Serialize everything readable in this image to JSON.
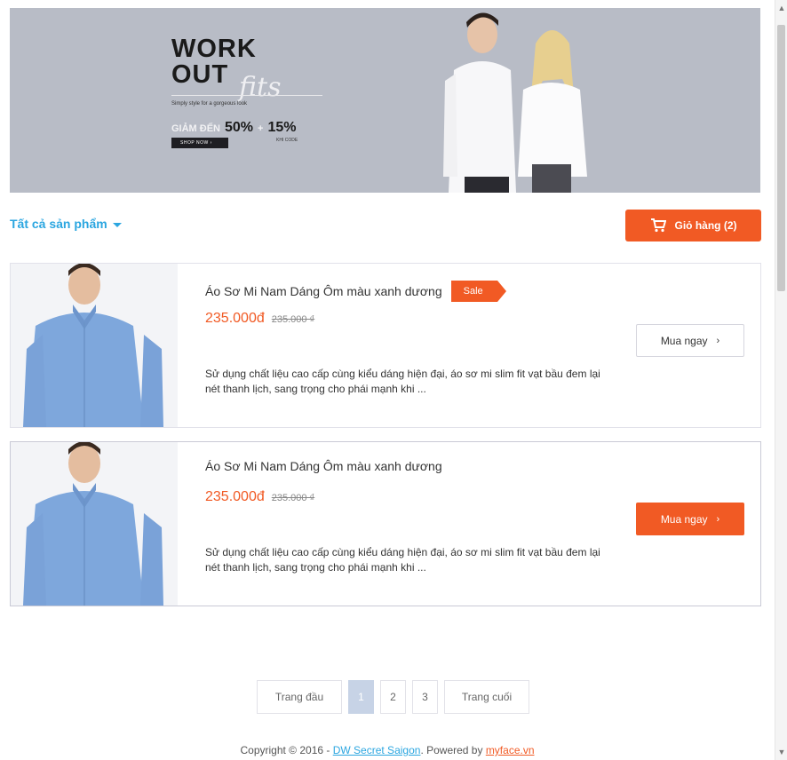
{
  "banner": {
    "headline_line1": "WORK",
    "headline_line2": "OUT",
    "script": "fits",
    "tagline": "Simply style for a gorgeous look",
    "sale_label": "GIẢM ĐẾN",
    "sale_pct1": "50%",
    "sale_plus": "+",
    "sale_pct2": "15%",
    "sale_note": "KHI CODE",
    "shop_label": "SHOP NOW ›",
    "bg_color": "#b8bcc6"
  },
  "toolbar": {
    "filter_label": "Tất cả sản phẩm",
    "cart_label": "Giỏ hàng (2)",
    "cart_icon": "cart-icon"
  },
  "products": [
    {
      "title": "Áo Sơ Mi Nam Dáng Ôm màu xanh dương",
      "badge": "Sale",
      "price": "235.000đ",
      "old_price": "235.000 ₫",
      "description": "Sử dụng chất liệu cao cấp cùng kiểu dáng hiện đại, áo sơ mi slim fit vạt bầu đem lại nét thanh lịch, sang trọng cho phái mạnh khi ...",
      "buy_label": "Mua ngay",
      "buy_style": "outline"
    },
    {
      "title": "Áo Sơ Mi Nam Dáng Ôm màu xanh dương",
      "badge": "",
      "price": "235.000đ",
      "old_price": "235.000 ₫",
      "description": "Sử dụng chất liệu cao cấp cùng kiểu dáng hiện đại, áo sơ mi slim fit vạt bầu đem lại nét thanh lịch, sang trọng cho phái mạnh khi ...",
      "buy_label": "Mua ngay",
      "buy_style": "primary"
    }
  ],
  "pagination": {
    "first": "Trang đầu",
    "pages": [
      "1",
      "2",
      "3"
    ],
    "active": "1",
    "last": "Trang cuối"
  },
  "footer": {
    "prefix": "Copyright © 2016 - ",
    "brand": "DW Secret Saigon",
    "middle": ". Powered by ",
    "powered": "myface.vn"
  },
  "colors": {
    "accent": "#f15a24",
    "link": "#2ba6e0",
    "page_active": "#c7d3e6"
  }
}
